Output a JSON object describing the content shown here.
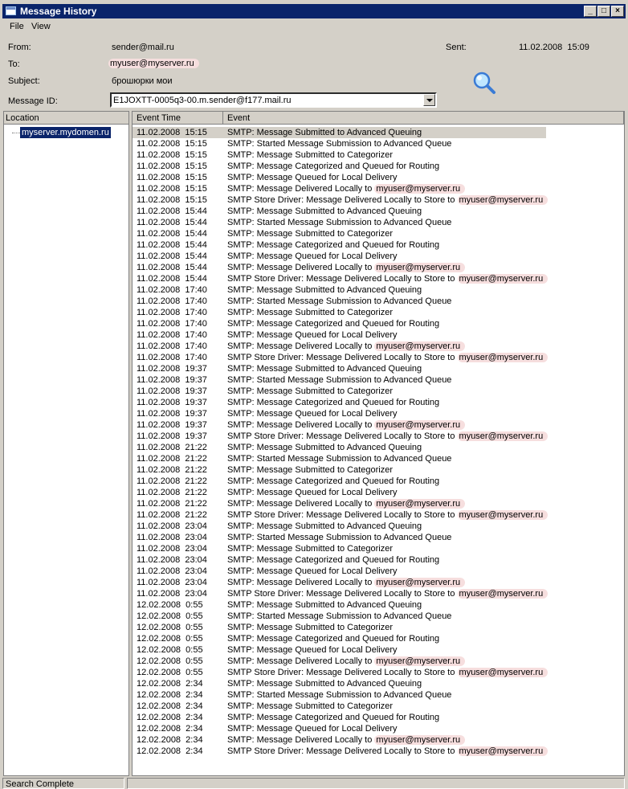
{
  "window": {
    "title": "Message History"
  },
  "menu": [
    "File",
    "View"
  ],
  "fields": {
    "from_label": "From:",
    "from_value": "sender@mail.ru",
    "to_label": "To:",
    "to_value": "myuser@myserver.ru",
    "subject_label": "Subject:",
    "subject_value": "брошюрки мои",
    "message_id_label": "Message ID:",
    "message_id_value": "E1JOXTT-0005q3-00.m.sender@f177.mail.ru",
    "sent_label": "Sent:",
    "sent_value": "11.02.2008  15:09"
  },
  "location": {
    "header": "Location",
    "item": "myserver.mydomen.ru"
  },
  "grid": {
    "headers": {
      "time": "Event Time",
      "event": "Event"
    },
    "sessions": [
      {
        "time": "11.02.2008  15:15",
        "selected_first": true
      },
      {
        "time": "11.02.2008  15:44"
      },
      {
        "time": "11.02.2008  17:40"
      },
      {
        "time": "11.02.2008  19:37"
      },
      {
        "time": "11.02.2008  21:22"
      },
      {
        "time": "11.02.2008  23:04"
      },
      {
        "time": "12.02.2008  0:55"
      },
      {
        "time": "12.02.2008  2:34"
      }
    ],
    "events": [
      "SMTP: Message Submitted to Advanced Queuing",
      "SMTP: Started Message Submission to Advanced Queue",
      "SMTP: Message Submitted to Categorizer",
      "SMTP: Message Categorized and Queued for Routing",
      "SMTP: Message Queued for Local Delivery",
      "SMTP: Message Delivered Locally to ",
      "SMTP Store Driver: Message Delivered Locally to Store to "
    ],
    "recipient": "myuser@myserver.ru"
  },
  "status": {
    "text": "Search Complete"
  },
  "colors": {
    "titlebar": "#0a246a",
    "highlight": "#f6dede",
    "chrome": "#d4d0c8"
  },
  "icons": {
    "window": "window-icon",
    "search": "magnifier-icon"
  }
}
